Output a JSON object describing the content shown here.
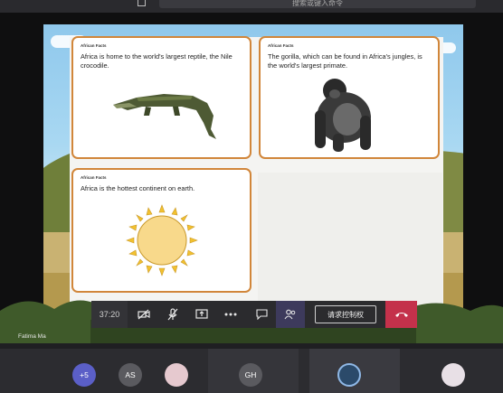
{
  "top_bar": {
    "search_placeholder": "搜索或键入命令"
  },
  "slide": {
    "cards": [
      {
        "tag": "African Facts",
        "text": "Africa is home to the world's largest reptile, the Nile crocodile."
      },
      {
        "tag": "African Facts",
        "text": "The gorilla, which can be found in Africa's jungles, is the world's largest primate."
      },
      {
        "tag": "African Facts",
        "text": "Africa is the hottest continent on earth."
      }
    ]
  },
  "controls": {
    "timer": "37:20",
    "request_control_label": "请求控制权"
  },
  "presenter": {
    "name": "Fatima Ma"
  },
  "participants": {
    "overflow": "+5",
    "initials_1": "AS",
    "initials_2": "GH"
  },
  "colors": {
    "card_border": "#d1863a",
    "hangup": "#c4314b",
    "overflow_badge": "#5b5fc7"
  }
}
